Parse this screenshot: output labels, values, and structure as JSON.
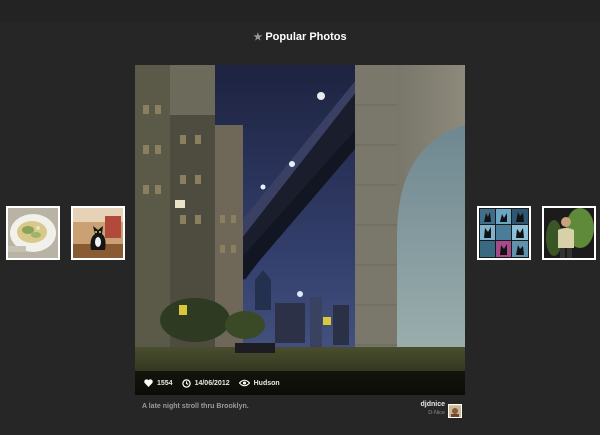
{
  "header": {
    "title": "Popular Photos",
    "star_icon": "star-icon"
  },
  "photo": {
    "likes": "1554",
    "date": "14/06/2012",
    "location": "Hudson",
    "caption": "A late night stroll thru Brooklyn.",
    "author_username": "djdnice",
    "author_fullname": "D-Nice"
  },
  "icons": {
    "likes": "heart-icon",
    "date": "clock-icon",
    "location": "eye-icon"
  },
  "colors": {
    "background": "#262626",
    "title_text": "#ffffff",
    "caption_text": "#9b9b9b"
  }
}
